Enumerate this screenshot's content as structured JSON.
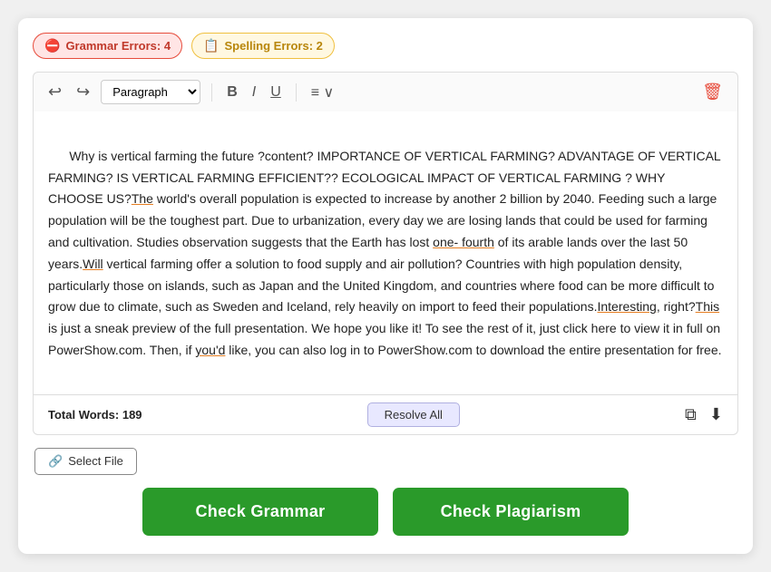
{
  "badges": {
    "grammar": {
      "label": "Grammar Errors: 4",
      "icon": "⛔"
    },
    "spelling": {
      "label": "Spelling Errors: 2",
      "icon": "📋"
    }
  },
  "toolbar": {
    "undo_label": "↩",
    "redo_label": "↪",
    "paragraph_option": "Paragraph",
    "bold_label": "B",
    "italic_label": "I",
    "underline_label": "U",
    "align_label": "≡",
    "align_arrow": "∨",
    "trash_label": "🗑"
  },
  "editor": {
    "content_plain": "Why is vertical farming the future ?content? IMPORTANCE OF VERTICAL FARMING? ADVANTAGE OF VERTICAL FARMING? IS VERTICAL FARMING EFFICIENT?? ECOLOGICAL IMPACT OF VERTICAL FARMING ? WHY CHOOSE US?",
    "content_suffix": "The world's overall population is expected to increase by another 2 billion by 2040. Feeding such a large population will be the toughest part. Due to urbanization, every day we are losing lands that could be used for farming and cultivation. Studies observation suggests that the Earth has lost ",
    "one_fourth": "one- fourth",
    "content_middle": " of its arable lands over the last 50 years.",
    "will_word": "Will",
    "content_middle2": " vertical farming offer a solution to food supply and air pollution? Countries with high population density, particularly those on islands, such as Japan and the United Kingdom, and countries where food can be more difficult to grow due to climate, such as Sweden and Iceland, rely heavily on import to feed their populations.",
    "interesting_word": "Interesting",
    "content_middle3": ", right?",
    "this_word": "This",
    "content_end": " is just a sneak preview of the full presentation. We hope you like it! To see the rest of it, just click here to view it in full on PowerShow.com. Then, if ",
    "youd_word": "you'd",
    "content_end2": " like, you can also log in to PowerShow.com to download the entire presentation for free."
  },
  "footer": {
    "word_count_label": "Total Words: 189",
    "resolve_all_label": "Resolve All",
    "copy_icon": "⧉",
    "download_icon": "⬇"
  },
  "select_file": {
    "label": "Select File",
    "icon": "🔗"
  },
  "actions": {
    "check_grammar_label": "Check Grammar",
    "check_plagiarism_label": "Check Plagiarism"
  }
}
